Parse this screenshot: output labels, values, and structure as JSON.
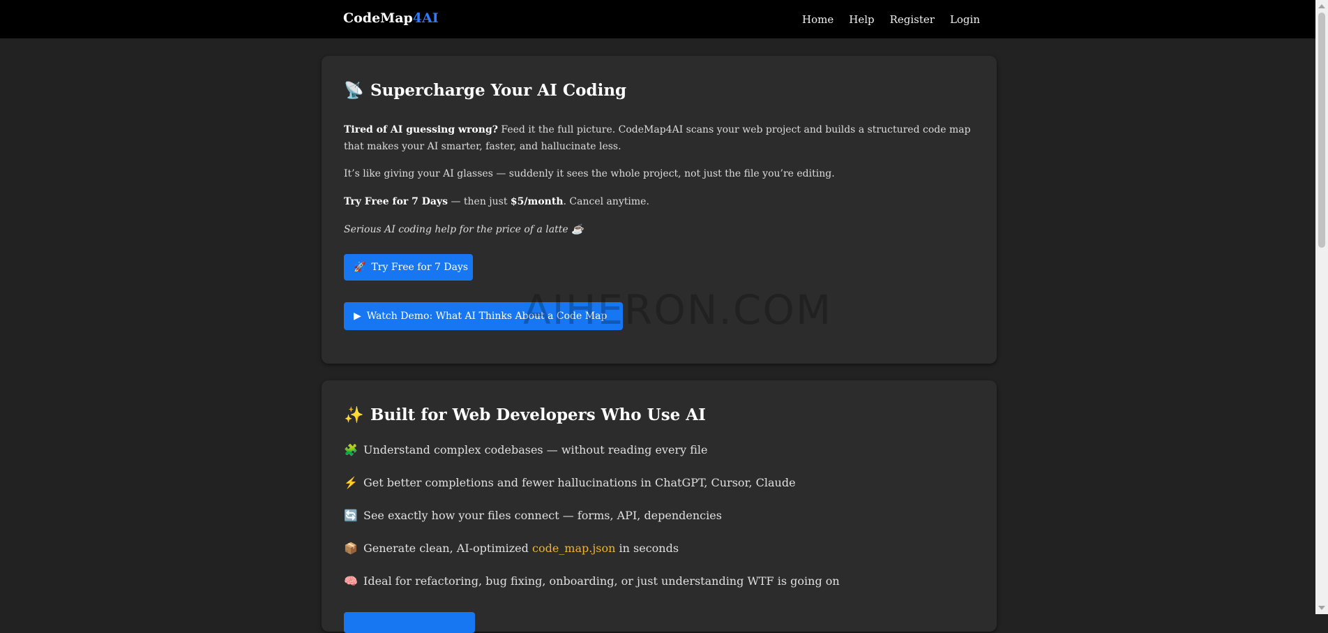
{
  "nav": {
    "brand_main": "CodeMap",
    "brand_accent": "4AI",
    "links": [
      "Home",
      "Help",
      "Register",
      "Login"
    ]
  },
  "hero": {
    "icon": "satellite-dish-icon",
    "title": "Supercharge Your AI Coding",
    "intro_bold": "Tired of AI guessing wrong?",
    "intro_text": " Feed it the full picture. CodeMap4AI scans your web project and builds a structured code map that makes your AI smarter, faster, and hallucinate less.",
    "glasses_text": "It’s like giving your AI glasses — suddenly it sees the whole project, not just the file you’re editing.",
    "trial_bold": "Try Free for 7 Days",
    "trial_mid": " — then just ",
    "price_bold": "$5/month",
    "trial_end": ". Cancel anytime.",
    "latte_text": "Serious AI coding help for the price of a latte ☕",
    "trial_button": "Try Free for 7 Days",
    "demo_button": "Watch Demo: What AI Thinks About a Code Map"
  },
  "watermark": "AIHERON.COM",
  "features": {
    "title": "Built for Web Developers Who Use AI",
    "items": [
      {
        "icon": "🧩",
        "text": "Understand complex codebases — without reading every file"
      },
      {
        "icon": "⚡",
        "text": "Get better completions and fewer hallucinations in ChatGPT, Cursor, Claude"
      },
      {
        "icon": "🔄",
        "text": "See exactly how your files connect — forms, API, dependencies"
      },
      {
        "icon": "📦",
        "text_before": "Generate clean, AI-optimized ",
        "code": "code_map.json",
        "text_after": " in seconds"
      },
      {
        "icon": "🧠",
        "text": "Ideal for refactoring, bug fixing, onboarding, or just understanding WTF is going on"
      }
    ]
  },
  "colors": {
    "accent": "#1777f3",
    "brand_accent": "#2f7dff",
    "card_bg": "#2c2c2c",
    "page_bg": "#222222",
    "code": "#f0b429"
  }
}
